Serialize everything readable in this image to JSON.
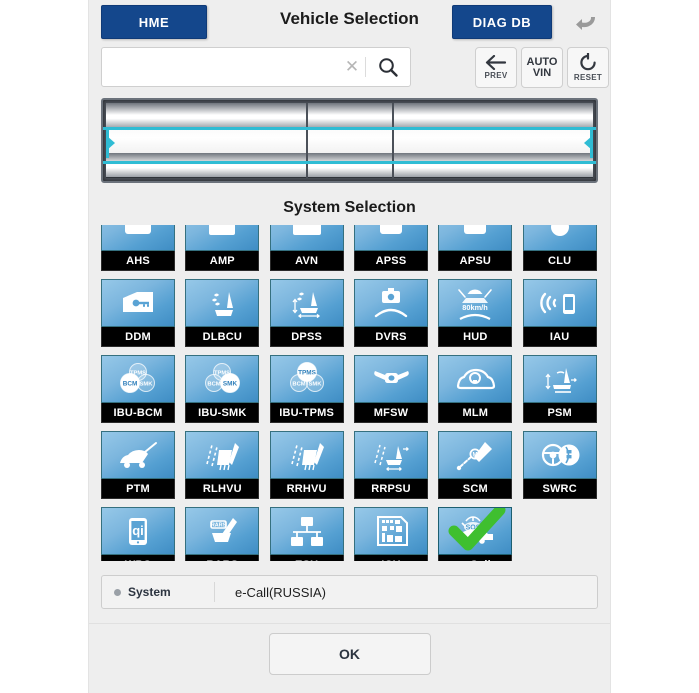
{
  "header": {
    "home_label": "HME",
    "title": "Vehicle Selection",
    "diagdb_label": "DIAG DB",
    "return_icon": "return-arrow-icon"
  },
  "search": {
    "value": "",
    "placeholder": "",
    "clear_icon": "clear-icon",
    "search_icon": "search-icon"
  },
  "tools": [
    {
      "name": "prev",
      "caption": "PREV",
      "icon": "arrow-left-icon"
    },
    {
      "name": "auto-vin",
      "line1": "AUTO",
      "line2": "VIN"
    },
    {
      "name": "reset",
      "caption": "RESET",
      "icon": "refresh-icon"
    }
  ],
  "vehicle_picker": {
    "highlight_color": "#2fbcd4",
    "columns": 3
  },
  "system_selection": {
    "title": "System Selection",
    "tiles": [
      {
        "label": "AHS",
        "icon": "ahs-icon",
        "selected": false,
        "clipped": true
      },
      {
        "label": "AMP",
        "icon": "amp-icon",
        "selected": false,
        "clipped": true
      },
      {
        "label": "AVN",
        "icon": "avn-icon",
        "selected": false,
        "clipped": true
      },
      {
        "label": "APSS",
        "icon": "apss-icon",
        "selected": false,
        "clipped": true
      },
      {
        "label": "APSU",
        "icon": "apsu-icon",
        "selected": false,
        "clipped": true
      },
      {
        "label": "CLU",
        "icon": "clu-icon",
        "selected": false,
        "clipped": true
      },
      {
        "label": "DDM",
        "icon": "door-key-icon",
        "selected": false
      },
      {
        "label": "DLBCU",
        "icon": "seat-blower-icon",
        "selected": false
      },
      {
        "label": "DPSS",
        "icon": "seat-position-icon",
        "selected": false
      },
      {
        "label": "DVRS",
        "icon": "dashcam-icon",
        "selected": false
      },
      {
        "label": "HUD",
        "icon": "hud-speed-icon",
        "selected": false,
        "icon_text": "80km/h"
      },
      {
        "label": "IAU",
        "icon": "phone-wireless-icon",
        "selected": false
      },
      {
        "label": "IBU-BCM",
        "icon": "venn-bcm-icon",
        "selected": false,
        "venn": "BCM"
      },
      {
        "label": "IBU-SMK",
        "icon": "venn-smk-icon",
        "selected": false,
        "venn": "SMK"
      },
      {
        "label": "IBU-TPMS",
        "icon": "venn-tpms-icon",
        "selected": false,
        "venn": "TPMS"
      },
      {
        "label": "MFSW",
        "icon": "steering-switch-icon",
        "selected": false
      },
      {
        "label": "MLM",
        "icon": "car-lamp-icon",
        "selected": false
      },
      {
        "label": "PSM",
        "icon": "power-seat-icon",
        "selected": false
      },
      {
        "label": "PTM",
        "icon": "trunk-icon",
        "selected": false
      },
      {
        "label": "RLHVU",
        "icon": "rear-left-vent-icon",
        "selected": false
      },
      {
        "label": "RRHVU",
        "icon": "rear-right-vent-icon",
        "selected": false
      },
      {
        "label": "RRPSU",
        "icon": "rear-seat-power-icon",
        "selected": false
      },
      {
        "label": "SCM",
        "icon": "steering-column-icon",
        "selected": false
      },
      {
        "label": "SWRC",
        "icon": "steering-wheel-icon",
        "selected": false
      },
      {
        "label": "WPC",
        "icon": "wireless-charge-icon",
        "selected": false
      },
      {
        "label": "RARS",
        "icon": "rear-seat-relax-icon",
        "selected": false
      },
      {
        "label": "ESU",
        "icon": "ethernet-switch-icon",
        "selected": false
      },
      {
        "label": "ICU",
        "icon": "icu-board-icon",
        "selected": false
      },
      {
        "label": "e-Call",
        "icon": "ecall-sos-icon",
        "selected": true
      }
    ]
  },
  "status": {
    "key": "System",
    "value": "e-Call(RUSSIA)"
  },
  "footer": {
    "ok_label": "OK"
  },
  "colors": {
    "brand_navy": "#14478c",
    "tile_blue": "#55a0d2",
    "highlight_cyan": "#2fbcd4",
    "check_green": "#3fbf2f",
    "page_bg": "#eeeeee"
  }
}
